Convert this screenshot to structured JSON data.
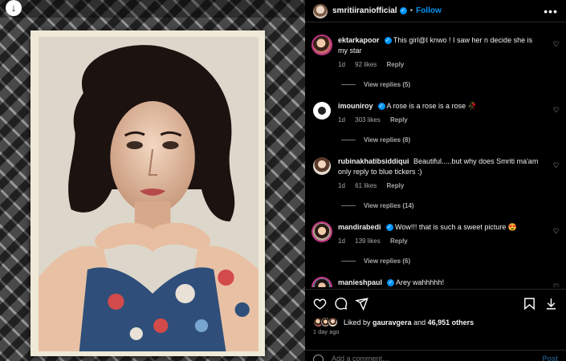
{
  "post": {
    "username": "smritiiraniofficial",
    "separator": "•",
    "follow_label": "Follow",
    "more_icon": "more-horizontal-icon"
  },
  "comments": [
    {
      "user": "ektarkapoor",
      "verified": true,
      "text": "This girl@I knwo ! I saw her n decide she is my star",
      "time": "1d",
      "likes": "92 likes",
      "reply": "Reply",
      "view_replies": "View replies (5)"
    },
    {
      "user": "imouniroy",
      "verified": true,
      "text": "A rose is a rose is a rose 🥀",
      "time": "1d",
      "likes": "303 likes",
      "reply": "Reply",
      "view_replies": "View replies (8)"
    },
    {
      "user": "rubinakhatibsiddiqui",
      "verified": false,
      "text": "Beautiful.....but why does Smriti ma'am only reply to blue tickers :)",
      "time": "1d",
      "likes": "61 likes",
      "reply": "Reply",
      "view_replies": "View replies (14)"
    },
    {
      "user": "mandirabedi",
      "verified": true,
      "text": "Wow!!! that is such a sweet picture 😍",
      "time": "1d",
      "likes": "139 likes",
      "reply": "Reply",
      "view_replies": "View replies (6)"
    },
    {
      "user": "manieshpaul",
      "verified": true,
      "text": "Arey wahhhhh!"
    }
  ],
  "actions": {
    "icons": [
      "heart-icon",
      "comment-icon",
      "share-icon",
      "bookmark-icon",
      "download-icon"
    ],
    "liked_by_prefix": "Liked by",
    "liked_by_user": "gauravgera",
    "liked_by_and": "and",
    "liked_by_others": "46,951 others",
    "time_ago": "1 day ago"
  },
  "composer": {
    "placeholder": "Add a comment…",
    "post_label": "Post"
  },
  "colors": {
    "accent": "#0095f6",
    "background": "#000000",
    "muted_text": "#a8a8a8"
  }
}
